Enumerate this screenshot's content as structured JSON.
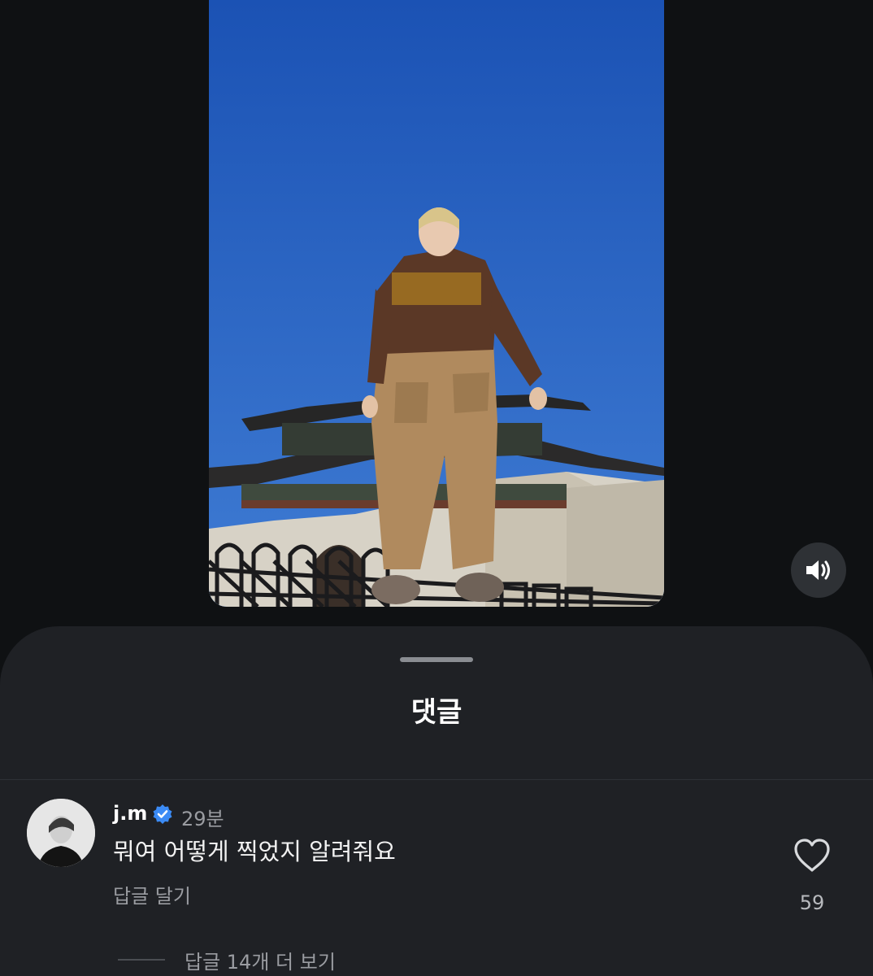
{
  "video": {
    "description_icon": "video-frame",
    "sound_icon": "speaker-on-icon"
  },
  "comments_sheet": {
    "title": "댓글",
    "comment": {
      "username": "j.m",
      "verified_icon": "verified-badge-icon",
      "timestamp": "29분",
      "text": "뭐여 어떻게 찍었지 알려줘요",
      "reply_label": "답글 달기",
      "like_icon": "heart-outline-icon",
      "like_count": "59",
      "view_replies_label": "답글 14개 더 보기"
    }
  },
  "colors": {
    "background": "#0f1113",
    "sheet": "#1f2125",
    "verified": "#3b8bf5",
    "muted_text": "#9a9ca1"
  }
}
